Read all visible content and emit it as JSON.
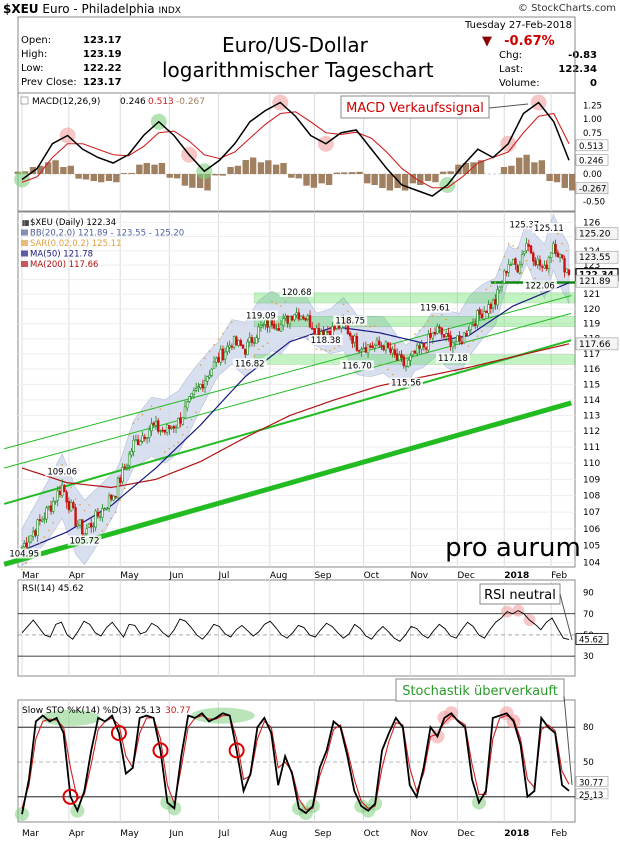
{
  "header": {
    "symbol": "$XEU",
    "name": "Euro - Philadelphia",
    "exchange": "INDX",
    "source": "© StockCharts.com",
    "date": "Tuesday  27-Feb-2018",
    "title_line1": "Euro/US-Dollar",
    "title_line2": "logarithmischer Tageschart",
    "stats_left": [
      {
        "label": "Open:",
        "value": "123.17"
      },
      {
        "label": "High:",
        "value": "123.19"
      },
      {
        "label": "Low:",
        "value": "122.22"
      },
      {
        "label": "Prev Close:",
        "value": "123.17"
      }
    ],
    "change_pct": "-0.67%",
    "stats_right": [
      {
        "label": "Chg:",
        "value": "-0.83"
      },
      {
        "label": "Last:",
        "value": "122.34"
      },
      {
        "label": "Volume:",
        "value": "0"
      }
    ]
  },
  "colors": {
    "up": "#1a8a1a",
    "down": "#cc1111",
    "ma50": "#1a1a80",
    "ma200": "#b01414",
    "sar": "#e0a040",
    "bb_fill": "#cfd8ec",
    "channel": "#22bb22",
    "zone": "#55dd55",
    "highlight_red": "#f2a0a0",
    "highlight_green": "#80d080"
  },
  "chart_data": [
    {
      "type": "line",
      "panel": "MACD",
      "legend": "MACD(12,26,9)",
      "legend_values": [
        "0.246",
        "0.513",
        "-0.267"
      ],
      "annotation": "MACD Verkaufssignal",
      "yticks": [
        "1.25",
        "1.00",
        "0.75",
        "0.50",
        "0.25",
        "0.00",
        "-0.25",
        "-0.50"
      ],
      "ylim": [
        -0.6,
        1.4
      ],
      "last_labels": [
        "0.513",
        "0.246",
        "-0.267"
      ],
      "x": [
        0,
        8,
        16,
        24,
        32,
        40,
        48,
        56,
        64,
        72,
        80,
        88,
        96,
        104,
        112,
        120,
        128,
        136,
        144,
        152,
        160,
        168,
        176,
        184,
        192,
        200,
        208,
        216,
        224,
        232,
        240,
        248,
        256,
        264,
        272,
        280,
        288
      ],
      "series": [
        {
          "values": [
            -0.1,
            0.1,
            0.55,
            0.7,
            0.45,
            0.3,
            0.2,
            0.35,
            0.7,
            0.95,
            0.7,
            0.35,
            0.05,
            0.25,
            0.55,
            0.95,
            1.15,
            1.3,
            1.05,
            0.7,
            0.55,
            0.75,
            0.8,
            0.45,
            0.1,
            -0.2,
            -0.3,
            -0.4,
            -0.2,
            0.15,
            0.45,
            0.3,
            0.55,
            1.1,
            1.3,
            0.95,
            0.25
          ]
        },
        {
          "values": [
            -0.15,
            -0.05,
            0.3,
            0.55,
            0.55,
            0.45,
            0.35,
            0.33,
            0.5,
            0.75,
            0.78,
            0.6,
            0.35,
            0.28,
            0.4,
            0.65,
            0.9,
            1.1,
            1.13,
            0.95,
            0.75,
            0.72,
            0.76,
            0.65,
            0.4,
            0.1,
            -0.1,
            -0.25,
            -0.25,
            -0.05,
            0.2,
            0.3,
            0.4,
            0.75,
            1.05,
            1.1,
            0.55
          ]
        }
      ],
      "histogram": [
        0.05,
        0.15,
        0.25,
        0.15,
        -0.1,
        -0.15,
        -0.15,
        0.02,
        0.2,
        0.2,
        -0.08,
        -0.25,
        -0.3,
        -0.03,
        0.15,
        0.3,
        0.25,
        0.2,
        -0.08,
        -0.25,
        -0.2,
        0.03,
        0.04,
        -0.2,
        -0.3,
        -0.3,
        -0.2,
        -0.15,
        0.05,
        0.2,
        0.25,
        0.0,
        0.15,
        0.35,
        0.25,
        -0.15,
        -0.3
      ]
    },
    {
      "type": "candlestick",
      "panel": "Price",
      "legend": [
        "$XEU (Daily) 122.34",
        "BB(20,2.0) 121.89 - 123.55 - 125.20",
        "SAR(0.02,0.2) 125.11",
        "MA(50) 121.78",
        "MA(200) 117.66"
      ],
      "brand": "pro aurum",
      "yticks": [
        126,
        125,
        124,
        123,
        122,
        121,
        120,
        119,
        118,
        117,
        116,
        115,
        114,
        113,
        112,
        111,
        110,
        109,
        108,
        107,
        106,
        105,
        104
      ],
      "ylim": [
        103.8,
        126.6
      ],
      "xlabels": [
        "Mar",
        "Apr",
        "May",
        "Jun",
        "Jul",
        "Aug",
        "Sep",
        "Oct",
        "Nov",
        "Dec",
        "2018",
        "Feb"
      ],
      "xlabel_pos": [
        0,
        21,
        44,
        66,
        88,
        111,
        131,
        153,
        174,
        195,
        216,
        237
      ],
      "price_labels": [
        {
          "text": "104.95",
          "x": 1,
          "y": 104.95,
          "pos": "below"
        },
        {
          "text": "109.06",
          "x": 18,
          "y": 109.06,
          "pos": "above"
        },
        {
          "text": "105.72",
          "x": 28,
          "y": 105.72,
          "pos": "below"
        },
        {
          "text": "119.09",
          "x": 107,
          "y": 119.09,
          "pos": "above"
        },
        {
          "text": "116.82",
          "x": 102,
          "y": 116.82,
          "pos": "below"
        },
        {
          "text": "120.68",
          "x": 123,
          "y": 120.68,
          "pos": "above"
        },
        {
          "text": "118.38",
          "x": 136,
          "y": 118.38,
          "pos": "below"
        },
        {
          "text": "118.75",
          "x": 147,
          "y": 118.75,
          "pos": "above"
        },
        {
          "text": "116.70",
          "x": 150,
          "y": 116.7,
          "pos": "below"
        },
        {
          "text": "115.56",
          "x": 172,
          "y": 115.56,
          "pos": "below"
        },
        {
          "text": "119.61",
          "x": 185,
          "y": 119.61,
          "pos": "above"
        },
        {
          "text": "117.18",
          "x": 193,
          "y": 117.18,
          "pos": "below"
        },
        {
          "text": "125.37",
          "x": 225,
          "y": 125.37,
          "pos": "above"
        },
        {
          "text": "125.11",
          "x": 236,
          "y": 125.11,
          "pos": "above"
        },
        {
          "text": "122.06",
          "x": 232,
          "y": 122.06,
          "pos": "below"
        }
      ],
      "right_labels": [
        {
          "text": "125.20",
          "y": 125.2
        },
        {
          "text": "123.55",
          "y": 123.55
        },
        {
          "text": "122.34",
          "y": 122.34
        },
        {
          "text": "121.89",
          "y": 121.89
        },
        {
          "text": "117.66",
          "y": 117.66
        }
      ],
      "close_keypoints": [
        [
          0,
          104.9
        ],
        [
          6,
          106
        ],
        [
          12,
          107.2
        ],
        [
          18,
          108.6
        ],
        [
          24,
          106.5
        ],
        [
          28,
          105.8
        ],
        [
          34,
          106.8
        ],
        [
          42,
          108.3
        ],
        [
          50,
          111.2
        ],
        [
          58,
          112.3
        ],
        [
          64,
          112
        ],
        [
          70,
          112.6
        ],
        [
          78,
          114.5
        ],
        [
          86,
          116.3
        ],
        [
          94,
          117.8
        ],
        [
          100,
          117.3
        ],
        [
          106,
          118.6
        ],
        [
          112,
          119.2
        ],
        [
          116,
          118.9
        ],
        [
          122,
          119.8
        ],
        [
          126,
          119.6
        ],
        [
          132,
          118.6
        ],
        [
          138,
          118.5
        ],
        [
          144,
          119
        ],
        [
          150,
          117.6
        ],
        [
          156,
          117.5
        ],
        [
          162,
          117.6
        ],
        [
          168,
          116.6
        ],
        [
          172,
          116.2
        ],
        [
          176,
          117
        ],
        [
          180,
          117.5
        ],
        [
          186,
          118.6
        ],
        [
          190,
          118
        ],
        [
          196,
          117.7
        ],
        [
          200,
          118.8
        ],
        [
          206,
          119.8
        ],
        [
          212,
          120.5
        ],
        [
          218,
          123.2
        ],
        [
          222,
          122.9
        ],
        [
          226,
          124.6
        ],
        [
          230,
          123.4
        ],
        [
          234,
          122.6
        ],
        [
          238,
          124.6
        ],
        [
          242,
          123.2
        ],
        [
          244,
          122.7
        ],
        [
          245,
          122.34
        ]
      ],
      "ma50_keypoints": [
        [
          0,
          104.7
        ],
        [
          20,
          105.8
        ],
        [
          40,
          107.4
        ],
        [
          60,
          109.7
        ],
        [
          80,
          112.4
        ],
        [
          100,
          115.5
        ],
        [
          120,
          117.8
        ],
        [
          140,
          118.8
        ],
        [
          160,
          118.4
        ],
        [
          180,
          117.7
        ],
        [
          200,
          118.2
        ],
        [
          220,
          120.2
        ],
        [
          245,
          121.78
        ]
      ],
      "ma200_keypoints": [
        [
          0,
          109.7
        ],
        [
          20,
          108.8
        ],
        [
          40,
          108.5
        ],
        [
          60,
          109
        ],
        [
          80,
          110.1
        ],
        [
          100,
          111.6
        ],
        [
          120,
          113
        ],
        [
          140,
          114
        ],
        [
          160,
          114.9
        ],
        [
          180,
          115.5
        ],
        [
          200,
          116.1
        ],
        [
          220,
          116.8
        ],
        [
          245,
          117.66
        ]
      ],
      "green_zones": [
        [
          120.4,
          121.1
        ],
        [
          118.8,
          119.5
        ],
        [
          116.3,
          116.95
        ]
      ],
      "trend_lines": [
        {
          "from": [
            -8,
            103.9
          ],
          "to": [
            246,
            113.8
          ],
          "weight": "heavy"
        },
        {
          "from": [
            -8,
            107.5
          ],
          "to": [
            246,
            117.9
          ],
          "weight": "medium"
        },
        {
          "from": [
            -8,
            110.9
          ],
          "to": [
            246,
            120.9
          ],
          "weight": "thin"
        },
        {
          "from": [
            -8,
            109.7
          ],
          "to": [
            246,
            119.7
          ],
          "weight": "thin"
        }
      ],
      "support_line": {
        "from": [
          210,
          121.8
        ],
        "to": [
          246,
          121.8
        ]
      },
      "n_days": 246
    },
    {
      "type": "line",
      "panel": "RSI",
      "legend": "RSI(14) 45.62",
      "annotation": "RSI neutral",
      "yticks": [
        "90",
        "70",
        "50",
        "30"
      ],
      "ylim": [
        15,
        100
      ],
      "last_label": "45.62",
      "values": [
        52,
        58,
        64,
        57,
        50,
        48,
        60,
        62,
        50,
        46,
        54,
        63,
        60,
        52,
        49,
        57,
        62,
        55,
        48,
        60,
        59,
        51,
        53,
        61,
        58,
        52,
        48,
        55,
        65,
        63,
        57,
        50,
        46,
        52,
        60,
        58,
        51,
        48,
        55,
        59,
        54,
        49,
        53,
        60,
        63,
        57,
        50,
        47,
        52,
        59,
        57,
        50,
        48,
        55,
        61,
        58,
        52,
        47,
        51,
        60,
        56,
        49,
        46,
        53,
        58,
        53,
        47,
        44,
        50,
        58,
        56,
        50,
        47,
        54,
        60,
        56,
        49,
        47,
        55,
        62,
        58,
        50,
        47,
        55,
        62,
        66,
        72,
        70,
        73,
        70,
        64,
        60,
        55,
        62,
        66,
        56,
        47,
        45.62
      ]
    },
    {
      "type": "line",
      "panel": "Slow STO",
      "legend": "Slow STO %K(14) %D(3)",
      "legend_values": [
        "25.13",
        "30.77"
      ],
      "annotation": "Stochastik überverkauft",
      "yticks": [
        "80",
        "50",
        "20"
      ],
      "ylim": [
        0,
        100
      ],
      "last_labels": [
        "30.77",
        "25.13"
      ],
      "series": [
        {
          "values": [
            5,
            35,
            85,
            90,
            85,
            88,
            75,
            20,
            8,
            25,
            60,
            88,
            85,
            90,
            75,
            40,
            45,
            88,
            90,
            88,
            60,
            15,
            10,
            55,
            90,
            88,
            92,
            85,
            88,
            92,
            90,
            60,
            25,
            40,
            80,
            88,
            75,
            30,
            55,
            40,
            10,
            6,
            12,
            45,
            60,
            85,
            80,
            55,
            25,
            12,
            8,
            14,
            60,
            75,
            88,
            80,
            30,
            20,
            45,
            80,
            72,
            88,
            92,
            85,
            80,
            35,
            15,
            25,
            88,
            90,
            92,
            85,
            65,
            20,
            25,
            88,
            80,
            75,
            30,
            25.13
          ]
        },
        {
          "values": [
            10,
            30,
            70,
            85,
            87,
            86,
            80,
            45,
            18,
            22,
            48,
            78,
            85,
            88,
            82,
            55,
            45,
            75,
            88,
            88,
            70,
            30,
            14,
            45,
            80,
            88,
            90,
            87,
            87,
            90,
            90,
            70,
            35,
            38,
            70,
            85,
            80,
            45,
            50,
            42,
            18,
            9,
            10,
            38,
            55,
            78,
            82,
            60,
            35,
            16,
            10,
            12,
            45,
            68,
            84,
            82,
            45,
            25,
            40,
            72,
            74,
            84,
            90,
            86,
            82,
            48,
            22,
            22,
            70,
            88,
            90,
            87,
            70,
            35,
            28,
            78,
            82,
            77,
            42,
            30.77
          ]
        }
      ],
      "red_circles": [
        14,
        28,
        40,
        49
      ],
      "green_marks": [
        0,
        12,
        21,
        40,
        57,
        60,
        69,
        73
      ],
      "red_highlights": [
        57,
        72,
        66,
        78
      ]
    }
  ]
}
